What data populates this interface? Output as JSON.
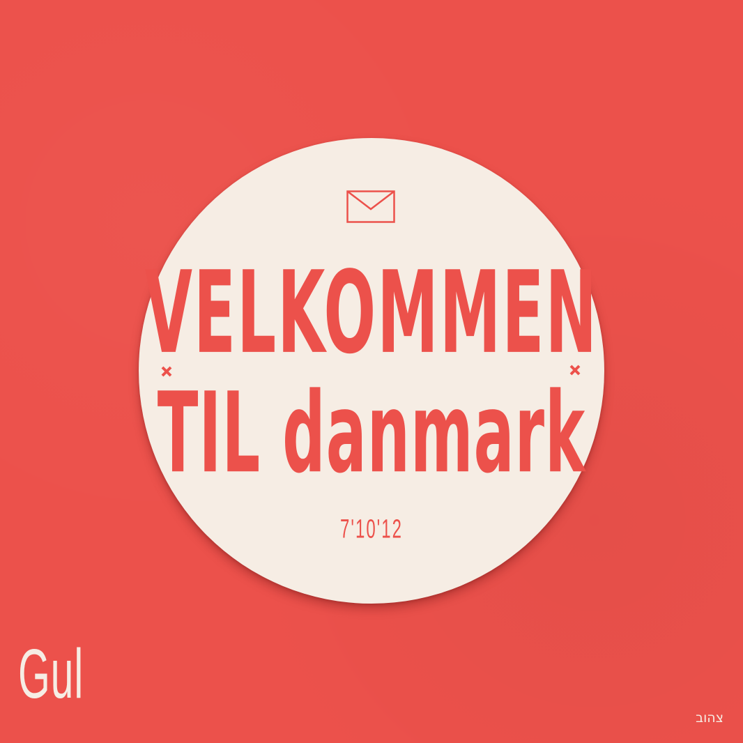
{
  "headline": {
    "line1": "VELKOMMEN",
    "line2": "TIL danmark"
  },
  "date": "7'10'12",
  "brand": "Gul",
  "brand_hebrew": "צהוב",
  "icons": {
    "envelope": "envelope-icon",
    "crosses": "cross-icon"
  },
  "colors": {
    "background": "#ec514b",
    "badge": "#f6ede4",
    "accent": "#ec514b",
    "text_light": "#f6ede4"
  }
}
